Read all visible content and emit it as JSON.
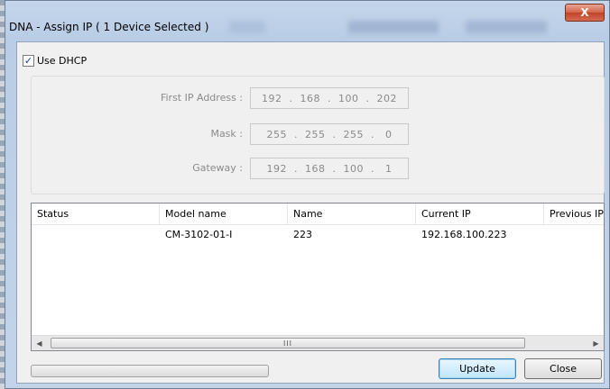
{
  "window": {
    "title": "DNA - Assign IP ( 1 Device Selected )",
    "close_glyph": "X"
  },
  "dhcp": {
    "label": "Use DHCP",
    "checked": true,
    "check_glyph": "✓"
  },
  "fields": [
    {
      "label": "First IP Address :",
      "value": "192  .  168  .  100  .  202"
    },
    {
      "label": "Mask :",
      "value": "255  .  255  .  255  .   0"
    },
    {
      "label": "Gateway :",
      "value": "192  .  168  .  100  .   1"
    }
  ],
  "table": {
    "columns": [
      "Status",
      "Model name",
      "Name",
      "Current IP",
      "Previous IP"
    ],
    "rows": [
      {
        "status": "",
        "model_name": "CM-3102-01-I",
        "name": "223",
        "current_ip": "192.168.100.223",
        "previous_ip": ""
      }
    ]
  },
  "scrollbar": {
    "left_glyph": "◀",
    "right_glyph": "▶",
    "thumb_grip": "III"
  },
  "progress": {
    "value": 0
  },
  "buttons": {
    "update": "Update",
    "close": "Close"
  }
}
